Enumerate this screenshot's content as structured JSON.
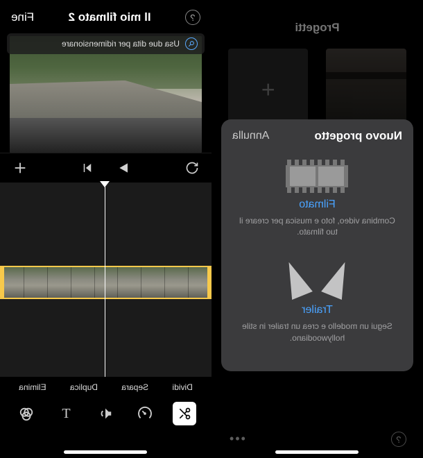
{
  "editor": {
    "title": "Il mio filmato 2",
    "done_label": "Fine",
    "help_glyph": "?",
    "tip_text": "Usa due dita per ridimensionare",
    "actions": {
      "split": "Dividi",
      "detach": "Separa",
      "duplicate": "Duplica",
      "delete": "Elimina"
    },
    "tools": {
      "scissors": "scissors",
      "speed": "speed",
      "volume": "volume",
      "text": "T",
      "filter": "filter"
    }
  },
  "projects": {
    "header": "Progetti",
    "sheet": {
      "title": "Nuovo progetto",
      "cancel": "Annulla",
      "movie": {
        "title": "Filmato",
        "desc": "Combina video, foto e musica per creare il tuo filmato."
      },
      "trailer": {
        "title": "Trailer",
        "desc": "Segui un modello e crea un trailer in stile hollywoodiano."
      }
    },
    "more_glyph": "•••"
  }
}
